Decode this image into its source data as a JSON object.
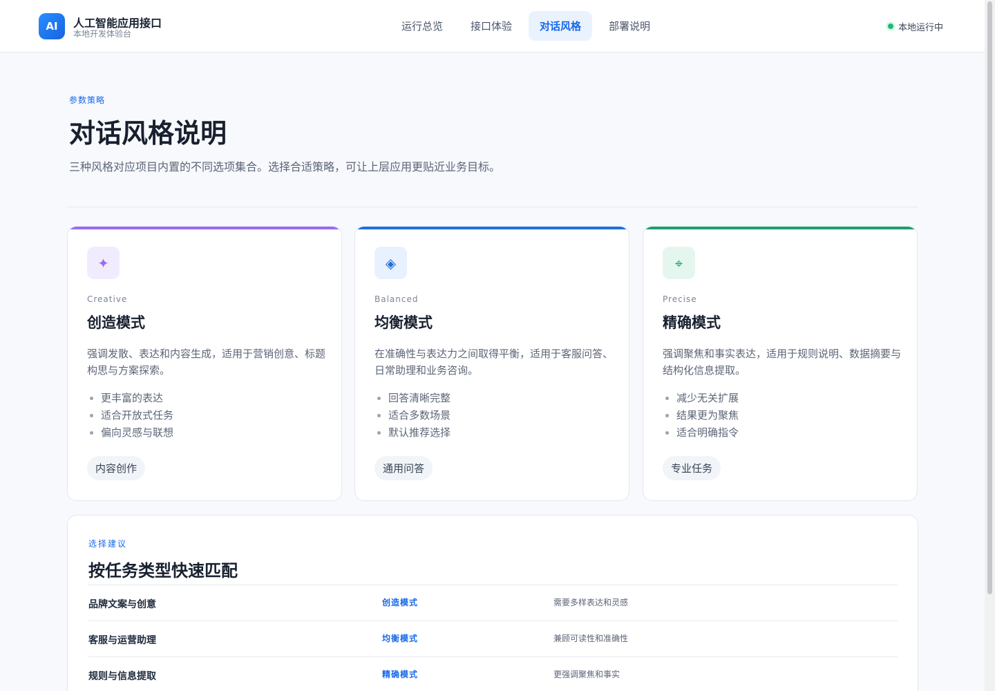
{
  "header": {
    "logo_text": "AI",
    "title": "人工智能应用接口",
    "subtitle": "本地开发体验台",
    "nav": [
      {
        "label": "运行总览"
      },
      {
        "label": "接口体验"
      },
      {
        "label": "对话风格"
      },
      {
        "label": "部署说明"
      }
    ],
    "active_nav": "对话风格",
    "status_label": "本地运行中"
  },
  "page": {
    "eyebrow": "参数策略",
    "title": "对话风格说明",
    "description": "三种风格对应项目内置的不同选项集合。选择合适策略，可让上层应用更贴近业务目标。"
  },
  "cards": [
    {
      "icon": "sparkle-icon",
      "glyph": "✦",
      "accent": "#9b6bef",
      "icon_bg": "#f1ecfd",
      "english": "Creative",
      "title": "创造模式",
      "description": "强调发散、表达和内容生成，适用于营销创意、标题构思与方案探索。",
      "points": [
        "更丰富的表达",
        "适合开放式任务",
        "偏向灵感与联想"
      ],
      "tag": "内容创作"
    },
    {
      "icon": "diamond-icon",
      "glyph": "◈",
      "accent": "#1f6fe0",
      "icon_bg": "#e8f1fe",
      "english": "Balanced",
      "title": "均衡模式",
      "description": "在准确性与表达力之间取得平衡，适用于客服问答、日常助理和业务咨询。",
      "points": [
        "回答清晰完整",
        "适合多数场景",
        "默认推荐选择"
      ],
      "tag": "通用问答"
    },
    {
      "icon": "crosshair-icon",
      "glyph": "⌖",
      "accent": "#1e9e6f",
      "icon_bg": "#e5f6ef",
      "english": "Precise",
      "title": "精确模式",
      "description": "强调聚焦和事实表达，适用于规则说明、数据摘要与结构化信息提取。",
      "points": [
        "减少无关扩展",
        "结果更为聚焦",
        "适合明确指令"
      ],
      "tag": "专业任务"
    }
  ],
  "match": {
    "eyebrow": "选择建议",
    "title": "按任务类型快速匹配",
    "rows": [
      {
        "task": "品牌文案与创意",
        "mode": "创造模式",
        "note": "需要多样表达和灵感"
      },
      {
        "task": "客服与运营助理",
        "mode": "均衡模式",
        "note": "兼顾可读性和准确性"
      },
      {
        "task": "规则与信息提取",
        "mode": "精确模式",
        "note": "更强调聚焦和事实"
      }
    ]
  }
}
